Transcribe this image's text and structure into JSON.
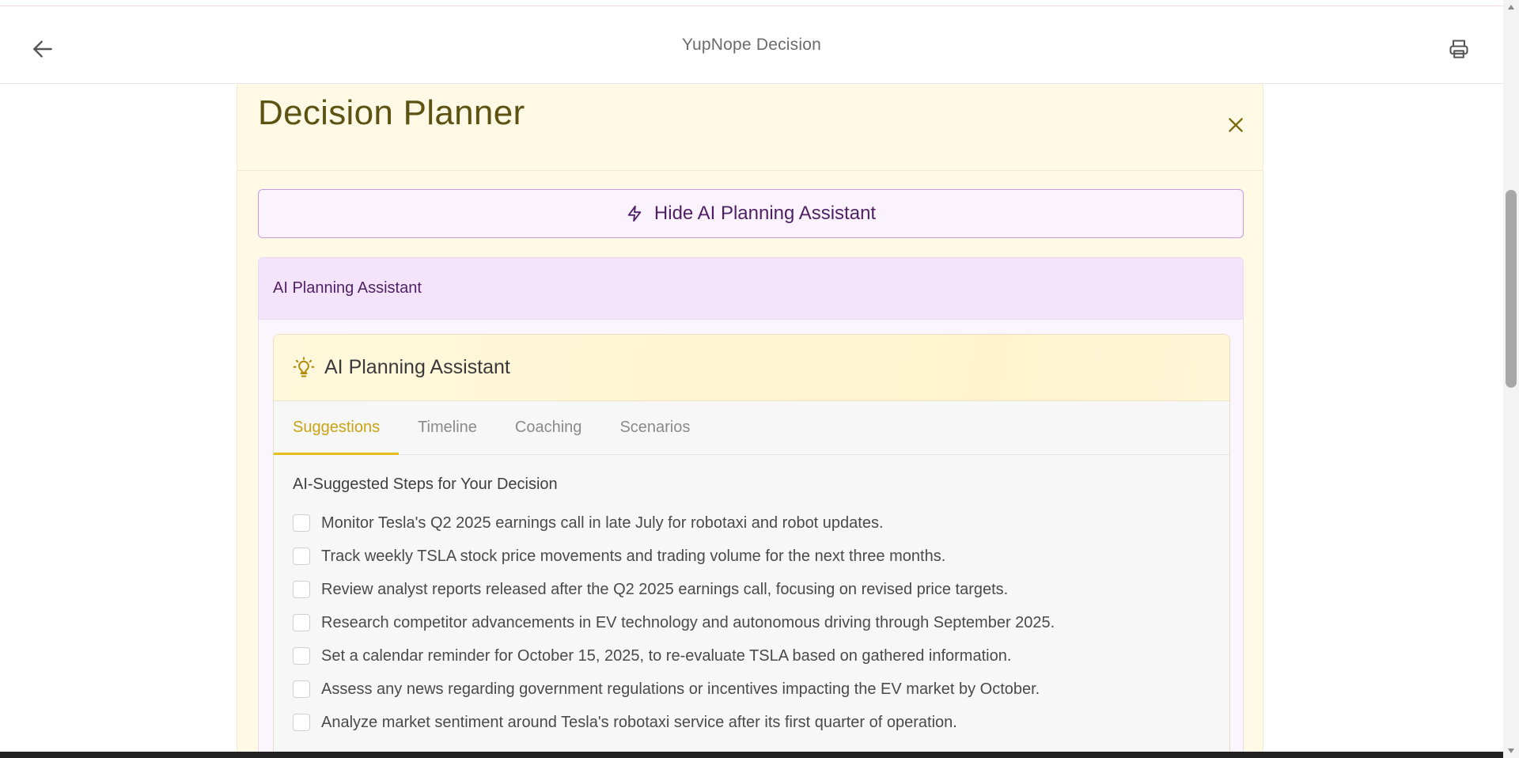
{
  "header": {
    "title": "YupNope Decision",
    "back_icon": "arrow-left-icon",
    "print_icon": "printer-icon"
  },
  "planner": {
    "title": "Decision Planner",
    "close_icon": "close-icon",
    "toggle_label": "Hide AI Planning Assistant",
    "toggle_icon": "lightning-icon"
  },
  "assistant_section": {
    "label": "AI Planning Assistant"
  },
  "assistant_card": {
    "title": "AI Planning Assistant",
    "icon": "lightbulb-icon",
    "tabs": [
      {
        "label": "Suggestions",
        "active": true
      },
      {
        "label": "Timeline",
        "active": false
      },
      {
        "label": "Coaching",
        "active": false
      },
      {
        "label": "Scenarios",
        "active": false
      }
    ],
    "steps_title": "AI-Suggested Steps for Your Decision",
    "steps": [
      {
        "text": "Monitor Tesla's Q2 2025 earnings call in late July for robotaxi and robot updates.",
        "checked": false
      },
      {
        "text": "Track weekly TSLA stock price movements and trading volume for the next three months.",
        "checked": false
      },
      {
        "text": "Review analyst reports released after the Q2 2025 earnings call, focusing on revised price targets.",
        "checked": false
      },
      {
        "text": "Research competitor advancements in EV technology and autonomous driving through September 2025.",
        "checked": false
      },
      {
        "text": "Set a calendar reminder for October 15, 2025, to re-evaluate TSLA based on gathered information.",
        "checked": false
      },
      {
        "text": "Assess any news regarding government regulations or incentives impacting the EV market by October.",
        "checked": false
      },
      {
        "text": "Analyze market sentiment around Tesla's robotaxi service after its first quarter of operation.",
        "checked": false
      }
    ]
  },
  "colors": {
    "panel_bg": "#fff9e6",
    "accent_gold": "#e6bd1a",
    "purple_text": "#4f1f66",
    "purple_border": "#c79bdd"
  }
}
